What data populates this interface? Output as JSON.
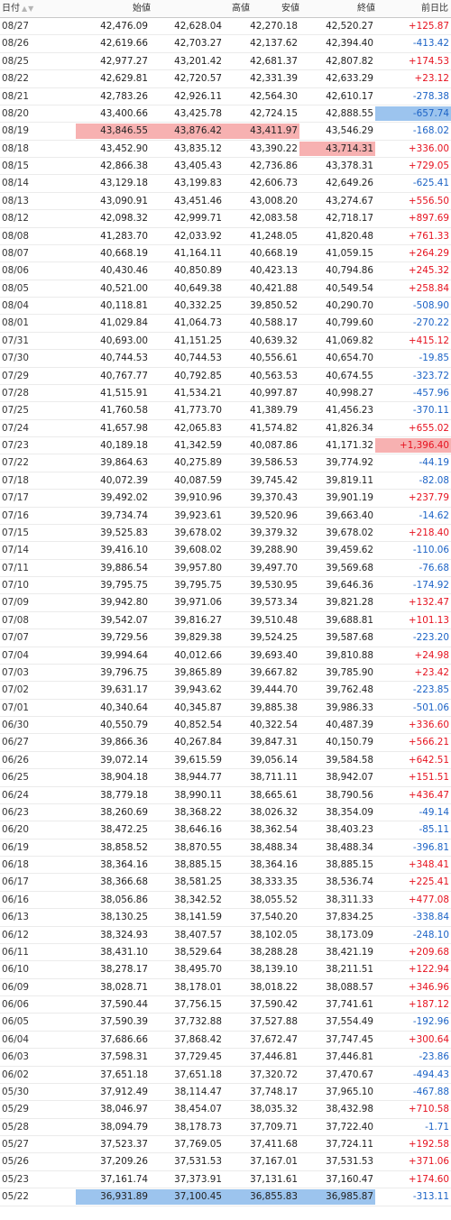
{
  "table": {
    "headers": {
      "date": "日付",
      "open": "始値",
      "high": "高値",
      "low": "安値",
      "close": "終値",
      "change": "前日比"
    },
    "sort_glyph": "▲▼",
    "highlight_colors": {
      "max": "#f7b1b1",
      "min": "#9cc4ee"
    },
    "change_colors": {
      "up": "#e6121f",
      "down": "#1c63c6"
    },
    "rows": [
      {
        "date": "08/27",
        "open": "42,476.09",
        "high": "42,628.04",
        "low": "42,270.18",
        "close": "42,520.27",
        "change": "+125.87",
        "dir": "up",
        "hl": {}
      },
      {
        "date": "08/26",
        "open": "42,619.66",
        "high": "42,703.27",
        "low": "42,137.62",
        "close": "42,394.40",
        "change": "-413.42",
        "dir": "dn",
        "hl": {}
      },
      {
        "date": "08/25",
        "open": "42,977.27",
        "high": "43,201.42",
        "low": "42,681.37",
        "close": "42,807.82",
        "change": "+174.53",
        "dir": "up",
        "hl": {}
      },
      {
        "date": "08/22",
        "open": "42,629.81",
        "high": "42,720.57",
        "low": "42,331.39",
        "close": "42,633.29",
        "change": "+23.12",
        "dir": "up",
        "hl": {}
      },
      {
        "date": "08/21",
        "open": "42,783.26",
        "high": "42,926.11",
        "low": "42,564.30",
        "close": "42,610.17",
        "change": "-278.38",
        "dir": "dn",
        "hl": {}
      },
      {
        "date": "08/20",
        "open": "43,400.66",
        "high": "43,425.78",
        "low": "42,724.15",
        "close": "42,888.55",
        "change": "-657.74",
        "dir": "dn",
        "hl": {
          "change": "min"
        }
      },
      {
        "date": "08/19",
        "open": "43,846.55",
        "high": "43,876.42",
        "low": "43,411.97",
        "close": "43,546.29",
        "change": "-168.02",
        "dir": "dn",
        "hl": {
          "open": "max",
          "high": "max",
          "low": "max"
        }
      },
      {
        "date": "08/18",
        "open": "43,452.90",
        "high": "43,835.12",
        "low": "43,390.22",
        "close": "43,714.31",
        "change": "+336.00",
        "dir": "up",
        "hl": {
          "close": "max"
        }
      },
      {
        "date": "08/15",
        "open": "42,866.38",
        "high": "43,405.43",
        "low": "42,736.86",
        "close": "43,378.31",
        "change": "+729.05",
        "dir": "up",
        "hl": {}
      },
      {
        "date": "08/14",
        "open": "43,129.18",
        "high": "43,199.83",
        "low": "42,606.73",
        "close": "42,649.26",
        "change": "-625.41",
        "dir": "dn",
        "hl": {}
      },
      {
        "date": "08/13",
        "open": "43,090.91",
        "high": "43,451.46",
        "low": "43,008.20",
        "close": "43,274.67",
        "change": "+556.50",
        "dir": "up",
        "hl": {}
      },
      {
        "date": "08/12",
        "open": "42,098.32",
        "high": "42,999.71",
        "low": "42,083.58",
        "close": "42,718.17",
        "change": "+897.69",
        "dir": "up",
        "hl": {}
      },
      {
        "date": "08/08",
        "open": "41,283.70",
        "high": "42,033.92",
        "low": "41,248.05",
        "close": "41,820.48",
        "change": "+761.33",
        "dir": "up",
        "hl": {}
      },
      {
        "date": "08/07",
        "open": "40,668.19",
        "high": "41,164.11",
        "low": "40,668.19",
        "close": "41,059.15",
        "change": "+264.29",
        "dir": "up",
        "hl": {}
      },
      {
        "date": "08/06",
        "open": "40,430.46",
        "high": "40,850.89",
        "low": "40,423.13",
        "close": "40,794.86",
        "change": "+245.32",
        "dir": "up",
        "hl": {}
      },
      {
        "date": "08/05",
        "open": "40,521.00",
        "high": "40,649.38",
        "low": "40,421.88",
        "close": "40,549.54",
        "change": "+258.84",
        "dir": "up",
        "hl": {}
      },
      {
        "date": "08/04",
        "open": "40,118.81",
        "high": "40,332.25",
        "low": "39,850.52",
        "close": "40,290.70",
        "change": "-508.90",
        "dir": "dn",
        "hl": {}
      },
      {
        "date": "08/01",
        "open": "41,029.84",
        "high": "41,064.73",
        "low": "40,588.17",
        "close": "40,799.60",
        "change": "-270.22",
        "dir": "dn",
        "hl": {}
      },
      {
        "date": "07/31",
        "open": "40,693.00",
        "high": "41,151.25",
        "low": "40,639.32",
        "close": "41,069.82",
        "change": "+415.12",
        "dir": "up",
        "hl": {}
      },
      {
        "date": "07/30",
        "open": "40,744.53",
        "high": "40,744.53",
        "low": "40,556.61",
        "close": "40,654.70",
        "change": "-19.85",
        "dir": "dn",
        "hl": {}
      },
      {
        "date": "07/29",
        "open": "40,767.77",
        "high": "40,792.85",
        "low": "40,563.53",
        "close": "40,674.55",
        "change": "-323.72",
        "dir": "dn",
        "hl": {}
      },
      {
        "date": "07/28",
        "open": "41,515.91",
        "high": "41,534.21",
        "low": "40,997.87",
        "close": "40,998.27",
        "change": "-457.96",
        "dir": "dn",
        "hl": {}
      },
      {
        "date": "07/25",
        "open": "41,760.58",
        "high": "41,773.70",
        "low": "41,389.79",
        "close": "41,456.23",
        "change": "-370.11",
        "dir": "dn",
        "hl": {}
      },
      {
        "date": "07/24",
        "open": "41,657.98",
        "high": "42,065.83",
        "low": "41,574.82",
        "close": "41,826.34",
        "change": "+655.02",
        "dir": "up",
        "hl": {}
      },
      {
        "date": "07/23",
        "open": "40,189.18",
        "high": "41,342.59",
        "low": "40,087.86",
        "close": "41,171.32",
        "change": "+1,396.40",
        "dir": "up",
        "hl": {
          "change": "max"
        }
      },
      {
        "date": "07/22",
        "open": "39,864.63",
        "high": "40,275.89",
        "low": "39,586.53",
        "close": "39,774.92",
        "change": "-44.19",
        "dir": "dn",
        "hl": {}
      },
      {
        "date": "07/18",
        "open": "40,072.39",
        "high": "40,087.59",
        "low": "39,745.42",
        "close": "39,819.11",
        "change": "-82.08",
        "dir": "dn",
        "hl": {}
      },
      {
        "date": "07/17",
        "open": "39,492.02",
        "high": "39,910.96",
        "low": "39,370.43",
        "close": "39,901.19",
        "change": "+237.79",
        "dir": "up",
        "hl": {}
      },
      {
        "date": "07/16",
        "open": "39,734.74",
        "high": "39,923.61",
        "low": "39,520.96",
        "close": "39,663.40",
        "change": "-14.62",
        "dir": "dn",
        "hl": {}
      },
      {
        "date": "07/15",
        "open": "39,525.83",
        "high": "39,678.02",
        "low": "39,379.32",
        "close": "39,678.02",
        "change": "+218.40",
        "dir": "up",
        "hl": {}
      },
      {
        "date": "07/14",
        "open": "39,416.10",
        "high": "39,608.02",
        "low": "39,288.90",
        "close": "39,459.62",
        "change": "-110.06",
        "dir": "dn",
        "hl": {}
      },
      {
        "date": "07/11",
        "open": "39,886.54",
        "high": "39,957.80",
        "low": "39,497.70",
        "close": "39,569.68",
        "change": "-76.68",
        "dir": "dn",
        "hl": {}
      },
      {
        "date": "07/10",
        "open": "39,795.75",
        "high": "39,795.75",
        "low": "39,530.95",
        "close": "39,646.36",
        "change": "-174.92",
        "dir": "dn",
        "hl": {}
      },
      {
        "date": "07/09",
        "open": "39,942.80",
        "high": "39,971.06",
        "low": "39,573.34",
        "close": "39,821.28",
        "change": "+132.47",
        "dir": "up",
        "hl": {}
      },
      {
        "date": "07/08",
        "open": "39,542.07",
        "high": "39,816.27",
        "low": "39,510.48",
        "close": "39,688.81",
        "change": "+101.13",
        "dir": "up",
        "hl": {}
      },
      {
        "date": "07/07",
        "open": "39,729.56",
        "high": "39,829.38",
        "low": "39,524.25",
        "close": "39,587.68",
        "change": "-223.20",
        "dir": "dn",
        "hl": {}
      },
      {
        "date": "07/04",
        "open": "39,994.64",
        "high": "40,012.66",
        "low": "39,693.40",
        "close": "39,810.88",
        "change": "+24.98",
        "dir": "up",
        "hl": {}
      },
      {
        "date": "07/03",
        "open": "39,796.75",
        "high": "39,865.89",
        "low": "39,667.82",
        "close": "39,785.90",
        "change": "+23.42",
        "dir": "up",
        "hl": {}
      },
      {
        "date": "07/02",
        "open": "39,631.17",
        "high": "39,943.62",
        "low": "39,444.70",
        "close": "39,762.48",
        "change": "-223.85",
        "dir": "dn",
        "hl": {}
      },
      {
        "date": "07/01",
        "open": "40,340.64",
        "high": "40,345.87",
        "low": "39,885.38",
        "close": "39,986.33",
        "change": "-501.06",
        "dir": "dn",
        "hl": {}
      },
      {
        "date": "06/30",
        "open": "40,550.79",
        "high": "40,852.54",
        "low": "40,322.54",
        "close": "40,487.39",
        "change": "+336.60",
        "dir": "up",
        "hl": {}
      },
      {
        "date": "06/27",
        "open": "39,866.36",
        "high": "40,267.84",
        "low": "39,847.31",
        "close": "40,150.79",
        "change": "+566.21",
        "dir": "up",
        "hl": {}
      },
      {
        "date": "06/26",
        "open": "39,072.14",
        "high": "39,615.59",
        "low": "39,056.14",
        "close": "39,584.58",
        "change": "+642.51",
        "dir": "up",
        "hl": {}
      },
      {
        "date": "06/25",
        "open": "38,904.18",
        "high": "38,944.77",
        "low": "38,711.11",
        "close": "38,942.07",
        "change": "+151.51",
        "dir": "up",
        "hl": {}
      },
      {
        "date": "06/24",
        "open": "38,779.18",
        "high": "38,990.11",
        "low": "38,665.61",
        "close": "38,790.56",
        "change": "+436.47",
        "dir": "up",
        "hl": {}
      },
      {
        "date": "06/23",
        "open": "38,260.69",
        "high": "38,368.22",
        "low": "38,026.32",
        "close": "38,354.09",
        "change": "-49.14",
        "dir": "dn",
        "hl": {}
      },
      {
        "date": "06/20",
        "open": "38,472.25",
        "high": "38,646.16",
        "low": "38,362.54",
        "close": "38,403.23",
        "change": "-85.11",
        "dir": "dn",
        "hl": {}
      },
      {
        "date": "06/19",
        "open": "38,858.52",
        "high": "38,870.55",
        "low": "38,488.34",
        "close": "38,488.34",
        "change": "-396.81",
        "dir": "dn",
        "hl": {}
      },
      {
        "date": "06/18",
        "open": "38,364.16",
        "high": "38,885.15",
        "low": "38,364.16",
        "close": "38,885.15",
        "change": "+348.41",
        "dir": "up",
        "hl": {}
      },
      {
        "date": "06/17",
        "open": "38,366.68",
        "high": "38,581.25",
        "low": "38,333.35",
        "close": "38,536.74",
        "change": "+225.41",
        "dir": "up",
        "hl": {}
      },
      {
        "date": "06/16",
        "open": "38,056.86",
        "high": "38,342.52",
        "low": "38,055.52",
        "close": "38,311.33",
        "change": "+477.08",
        "dir": "up",
        "hl": {}
      },
      {
        "date": "06/13",
        "open": "38,130.25",
        "high": "38,141.59",
        "low": "37,540.20",
        "close": "37,834.25",
        "change": "-338.84",
        "dir": "dn",
        "hl": {}
      },
      {
        "date": "06/12",
        "open": "38,324.93",
        "high": "38,407.57",
        "low": "38,102.05",
        "close": "38,173.09",
        "change": "-248.10",
        "dir": "dn",
        "hl": {}
      },
      {
        "date": "06/11",
        "open": "38,431.10",
        "high": "38,529.64",
        "low": "38,288.28",
        "close": "38,421.19",
        "change": "+209.68",
        "dir": "up",
        "hl": {}
      },
      {
        "date": "06/10",
        "open": "38,278.17",
        "high": "38,495.70",
        "low": "38,139.10",
        "close": "38,211.51",
        "change": "+122.94",
        "dir": "up",
        "hl": {}
      },
      {
        "date": "06/09",
        "open": "38,028.71",
        "high": "38,178.01",
        "low": "38,018.22",
        "close": "38,088.57",
        "change": "+346.96",
        "dir": "up",
        "hl": {}
      },
      {
        "date": "06/06",
        "open": "37,590.44",
        "high": "37,756.15",
        "low": "37,590.42",
        "close": "37,741.61",
        "change": "+187.12",
        "dir": "up",
        "hl": {}
      },
      {
        "date": "06/05",
        "open": "37,590.39",
        "high": "37,732.88",
        "low": "37,527.88",
        "close": "37,554.49",
        "change": "-192.96",
        "dir": "dn",
        "hl": {}
      },
      {
        "date": "06/04",
        "open": "37,686.66",
        "high": "37,868.42",
        "low": "37,672.47",
        "close": "37,747.45",
        "change": "+300.64",
        "dir": "up",
        "hl": {}
      },
      {
        "date": "06/03",
        "open": "37,598.31",
        "high": "37,729.45",
        "low": "37,446.81",
        "close": "37,446.81",
        "change": "-23.86",
        "dir": "dn",
        "hl": {}
      },
      {
        "date": "06/02",
        "open": "37,651.18",
        "high": "37,651.18",
        "low": "37,320.72",
        "close": "37,470.67",
        "change": "-494.43",
        "dir": "dn",
        "hl": {}
      },
      {
        "date": "05/30",
        "open": "37,912.49",
        "high": "38,114.47",
        "low": "37,748.17",
        "close": "37,965.10",
        "change": "-467.88",
        "dir": "dn",
        "hl": {}
      },
      {
        "date": "05/29",
        "open": "38,046.97",
        "high": "38,454.07",
        "low": "38,035.32",
        "close": "38,432.98",
        "change": "+710.58",
        "dir": "up",
        "hl": {}
      },
      {
        "date": "05/28",
        "open": "38,094.79",
        "high": "38,178.73",
        "low": "37,709.71",
        "close": "37,722.40",
        "change": "-1.71",
        "dir": "dn",
        "hl": {}
      },
      {
        "date": "05/27",
        "open": "37,523.37",
        "high": "37,769.05",
        "low": "37,411.68",
        "close": "37,724.11",
        "change": "+192.58",
        "dir": "up",
        "hl": {}
      },
      {
        "date": "05/26",
        "open": "37,209.26",
        "high": "37,531.53",
        "low": "37,167.01",
        "close": "37,531.53",
        "change": "+371.06",
        "dir": "up",
        "hl": {}
      },
      {
        "date": "05/23",
        "open": "37,161.74",
        "high": "37,373.91",
        "low": "37,131.61",
        "close": "37,160.47",
        "change": "+174.60",
        "dir": "up",
        "hl": {}
      },
      {
        "date": "05/22",
        "open": "36,931.89",
        "high": "37,100.45",
        "low": "36,855.83",
        "close": "36,985.87",
        "change": "-313.11",
        "dir": "dn",
        "hl": {
          "open": "min",
          "high": "min",
          "low": "min",
          "close": "min"
        }
      }
    ]
  }
}
